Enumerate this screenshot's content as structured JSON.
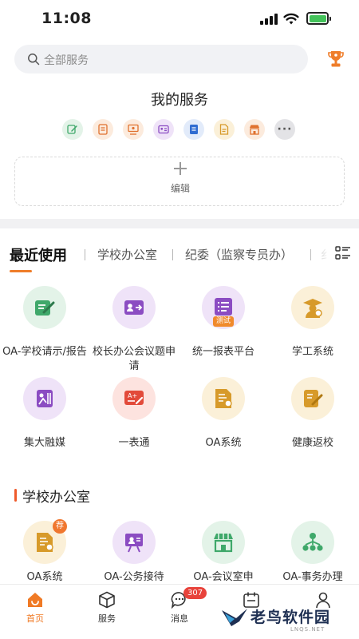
{
  "status_bar": {
    "time": "11:08"
  },
  "search": {
    "placeholder": "全部服务"
  },
  "my_services": {
    "title": "我的服务",
    "favorites": [
      {
        "icon": "school-request-icon",
        "color": "#3fa86a",
        "bg": "#e3f3e8"
      },
      {
        "icon": "document-icon",
        "color": "#e0712e",
        "bg": "#fcebdd"
      },
      {
        "icon": "meeting-icon",
        "color": "#e0712e",
        "bg": "#fcebdd"
      },
      {
        "icon": "id-card-icon",
        "color": "#8b4cc2",
        "bg": "#efe3f8"
      },
      {
        "icon": "form-icon",
        "color": "#2f6cd1",
        "bg": "#e2ebfa"
      },
      {
        "icon": "report-icon",
        "color": "#d79a2a",
        "bg": "#fbf0d8"
      },
      {
        "icon": "store-icon",
        "color": "#e0712e",
        "bg": "#fcebdd"
      }
    ],
    "more_label": "···",
    "edit_label": "编辑"
  },
  "tabs": {
    "items": [
      "最近使用",
      "学校办公室",
      "纪委（监察专员办）",
      "纟"
    ],
    "active": 0
  },
  "recent_apps": [
    {
      "label": "OA-学校请示/报告",
      "icon": "school-request-icon",
      "color": "#3fa86a",
      "bg": "#e3f3e8"
    },
    {
      "label": "校长办公会议题申请",
      "icon": "id-card-icon",
      "color": "#8b4cc2",
      "bg": "#efe3f8"
    },
    {
      "label": "统一报表平台",
      "icon": "list-icon",
      "color": "#8b4cc2",
      "bg": "#efe3f8",
      "badge": "测试"
    },
    {
      "label": "学工系统",
      "icon": "graduate-icon",
      "color": "#d79a2a",
      "bg": "#fbf0d8"
    },
    {
      "label": "集大融媒",
      "icon": "media-icon",
      "color": "#8b4cc2",
      "bg": "#efe3f8"
    },
    {
      "label": "一表通",
      "icon": "grade-board-icon",
      "color": "#e24a3a",
      "bg": "#fde3df"
    },
    {
      "label": "OA系统",
      "icon": "oa-doc-icon",
      "color": "#d79a2a",
      "bg": "#fbf0d8"
    },
    {
      "label": "健康返校",
      "icon": "health-form-icon",
      "color": "#d79a2a",
      "bg": "#fbf0d8"
    }
  ],
  "school_office": {
    "title": "学校办公室",
    "apps": [
      {
        "label": "OA系统",
        "icon": "oa-doc-icon",
        "color": "#d79a2a",
        "bg": "#fbf0d8",
        "badge": "荐"
      },
      {
        "label": "OA-公务接待",
        "icon": "reception-icon",
        "color": "#8b4cc2",
        "bg": "#efe3f8"
      },
      {
        "label": "OA-会议室申",
        "icon": "store-icon",
        "color": "#3fa86a",
        "bg": "#e3f3e8"
      },
      {
        "label": "OA-事务办理",
        "icon": "org-chart-icon",
        "color": "#3fa86a",
        "bg": "#e3f3e8"
      }
    ]
  },
  "bottom_nav": [
    {
      "label": "首页",
      "icon": "home-icon",
      "active": true
    },
    {
      "label": "服务",
      "icon": "cube-icon",
      "active": false
    },
    {
      "label": "消息",
      "icon": "chat-icon",
      "active": false,
      "badge": "307"
    },
    {
      "label": "",
      "icon": "calendar-icon",
      "active": false
    },
    {
      "label": "",
      "icon": "person-icon",
      "active": false
    }
  ],
  "watermark": {
    "text": "老鸟软件园",
    "sub": "LNQS.NET"
  },
  "accent_color": "#ef7d2a"
}
